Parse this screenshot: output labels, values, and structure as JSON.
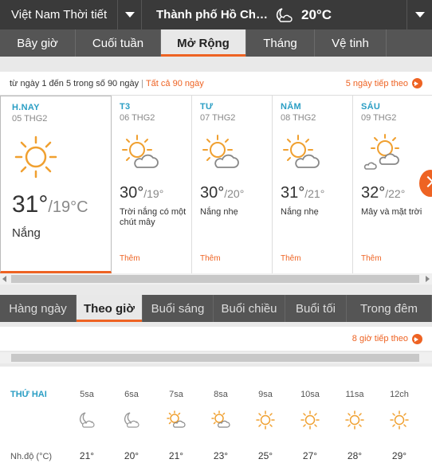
{
  "topbar": {
    "region": "Việt Nam Thời tiết",
    "city": "Thành phố Hồ Chí ...",
    "current_temp": "20°C",
    "current_icon": "moon-cloud-icon"
  },
  "tabs": [
    "Bây giờ",
    "Cuối tuần",
    "Mở Rộng",
    "Tháng",
    "Vệ tinh"
  ],
  "active_tab": "Mở Rộng",
  "range": {
    "text": "từ ngày 1 đến 5 trong số 90 ngày",
    "all_link": "Tất cả 90 ngày",
    "next_link": "5 ngày tiếp theo"
  },
  "days": [
    {
      "name": "H.NAY",
      "date": "05 THG2",
      "hi": "31°",
      "lo": "/19°C",
      "desc": "Nắng",
      "icon": "sun-icon",
      "more": ""
    },
    {
      "name": "T3",
      "date": "06 THG2",
      "hi": "30°",
      "lo": "/19°",
      "desc": "Trời nắng có một chút mây",
      "icon": "sun-cloud-icon",
      "more": "Thêm"
    },
    {
      "name": "TƯ",
      "date": "07 THG2",
      "hi": "30°",
      "lo": "/20°",
      "desc": "Nắng nhẹ",
      "icon": "sun-cloud-icon",
      "more": "Thêm"
    },
    {
      "name": "NĂM",
      "date": "08 THG2",
      "hi": "31°",
      "lo": "/21°",
      "desc": "Nắng nhẹ",
      "icon": "sun-cloud-icon",
      "more": "Thêm"
    },
    {
      "name": "SÁU",
      "date": "09 THG2",
      "hi": "32°",
      "lo": "/22°",
      "desc": "Mây và mặt trời",
      "icon": "sun-cloud-icon",
      "more": "Thêm"
    }
  ],
  "subtabs": [
    "Hàng ngày",
    "Theo giờ",
    "Buổi sáng",
    "Buổi chiều",
    "Buổi tối",
    "Trong đêm"
  ],
  "active_subtab": "Theo giờ",
  "hourly": {
    "next_link": "8 giờ tiếp theo",
    "day_label": "THỨ HAI",
    "row_label": "Nh.độ (°C)",
    "hours": [
      {
        "time": "5sa",
        "temp": "21°",
        "icon": "moon-cloud-icon"
      },
      {
        "time": "6sa",
        "temp": "20°",
        "icon": "moon-cloud-icon"
      },
      {
        "time": "7sa",
        "temp": "21°",
        "icon": "sun-cloud-icon"
      },
      {
        "time": "8sa",
        "temp": "23°",
        "icon": "sun-cloud-icon"
      },
      {
        "time": "9sa",
        "temp": "25°",
        "icon": "sun-icon"
      },
      {
        "time": "10sa",
        "temp": "27°",
        "icon": "sun-icon"
      },
      {
        "time": "11sa",
        "temp": "28°",
        "icon": "sun-icon"
      },
      {
        "time": "12ch",
        "temp": "29°",
        "icon": "sun-icon"
      }
    ]
  },
  "colors": {
    "accent": "#ee6323",
    "day_label": "#2a9ec4",
    "dark_bar": "#3a3a3a",
    "tab_bar": "#555555"
  }
}
